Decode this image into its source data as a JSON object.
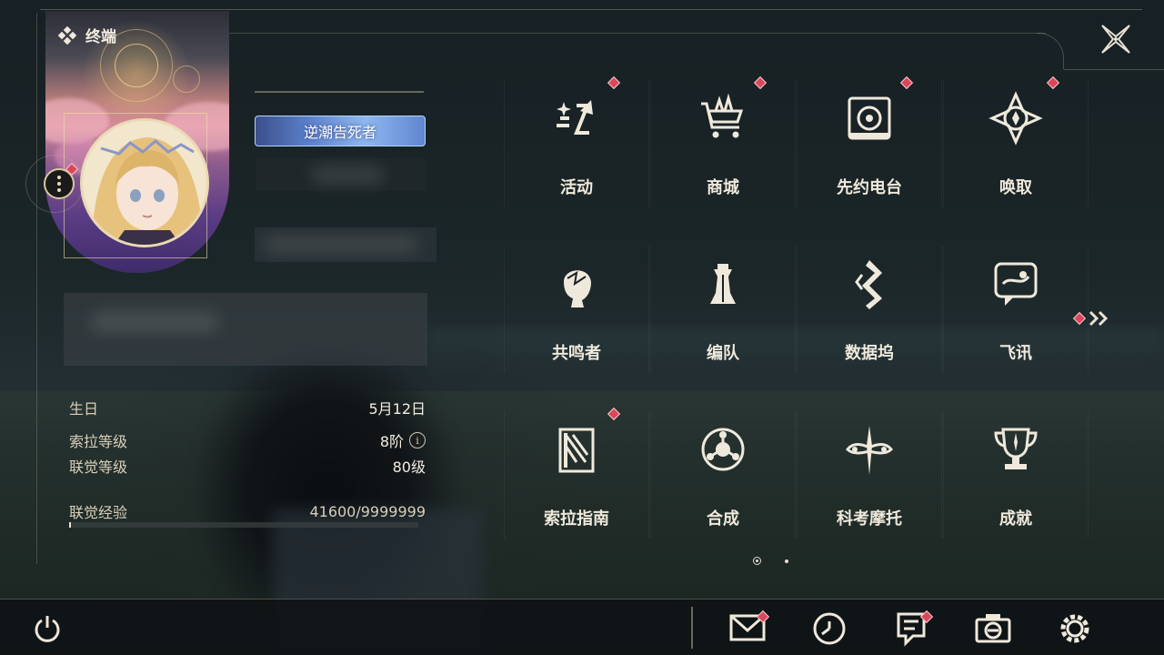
{
  "header": {
    "title": "终端"
  },
  "profile": {
    "title_badge": "逆潮告死者",
    "stats": [
      {
        "label": "生日",
        "value": "5月12日"
      },
      {
        "label": "索拉等级",
        "value": "8阶",
        "has_info": true
      },
      {
        "label": "联觉等级",
        "value": "80级"
      },
      {
        "label": "联觉经验",
        "value": "41600/9999999"
      }
    ],
    "exp_progress": 0.0042
  },
  "features": [
    {
      "label": "活动",
      "icon": "activity-icon",
      "badge": true
    },
    {
      "label": "商城",
      "icon": "shop-cart-icon",
      "badge": true
    },
    {
      "label": "先约电台",
      "icon": "radio-icon",
      "badge": true
    },
    {
      "label": "唤取",
      "icon": "summon-compass-icon",
      "badge": true
    },
    {
      "label": "共鸣者",
      "icon": "resonator-head-icon",
      "badge": false
    },
    {
      "label": "编队",
      "icon": "team-chess-icon",
      "badge": false
    },
    {
      "label": "数据坞",
      "icon": "data-dock-icon",
      "badge": false
    },
    {
      "label": "飞讯",
      "icon": "chat-message-icon",
      "badge": false
    },
    {
      "label": "索拉指南",
      "icon": "guide-book-icon",
      "badge": true
    },
    {
      "label": "合成",
      "icon": "synthesis-icon",
      "badge": false
    },
    {
      "label": "科考摩托",
      "icon": "motorcycle-icon",
      "badge": false
    },
    {
      "label": "成就",
      "icon": "trophy-icon",
      "badge": false
    }
  ],
  "bottom_bar": {
    "buttons": [
      {
        "name": "mail-icon",
        "badge": true
      },
      {
        "name": "clock-icon",
        "badge": false
      },
      {
        "name": "notice-icon",
        "badge": true
      },
      {
        "name": "camera-icon",
        "badge": false
      },
      {
        "name": "settings-gear-icon",
        "badge": false
      }
    ]
  },
  "pager": {
    "pages": 2,
    "current": 1
  },
  "colors": {
    "accent_badge": "#d8485a",
    "text": "#efe9dc",
    "frame": "#c8be a0",
    "title_badge_bg": "#5a7ec8"
  }
}
